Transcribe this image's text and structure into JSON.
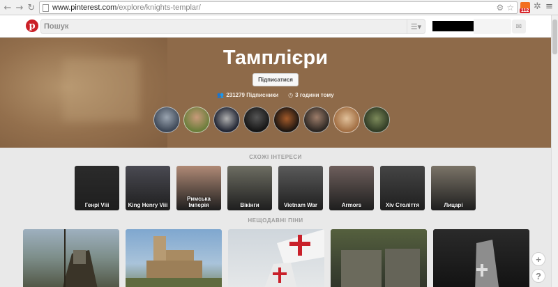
{
  "browser": {
    "url_host": "www.pinterest.com",
    "url_path": "/explore/knights-templar/",
    "ext_badge": "112"
  },
  "header": {
    "search_placeholder": "Пошук"
  },
  "hero": {
    "title": "Тамплієри",
    "follow_label": "Підписатися",
    "followers": "231279 Підписники",
    "updated": "3 години тому"
  },
  "related": {
    "heading": "СХОЖІ ІНТЕРЕСИ",
    "items": [
      {
        "label": "Генрі Viii",
        "color": "#2b2b2b"
      },
      {
        "label": "King Henry Viii",
        "color": "#4a4a52"
      },
      {
        "label": "Римська Імперія",
        "color": "#b08a76"
      },
      {
        "label": "Вікінги",
        "color": "#6d6d62"
      },
      {
        "label": "Vietnam War",
        "color": "#5a5a5a"
      },
      {
        "label": "Armors",
        "color": "#6e5f5c"
      },
      {
        "label": "Xiv Століття",
        "color": "#454545"
      },
      {
        "label": "Лицарі",
        "color": "#7b7468"
      }
    ]
  },
  "recent": {
    "heading": "НЕЩОДАВНІ ПІНИ"
  },
  "colors": {
    "brand_red": "#cb2027",
    "hero_brown": "#8e6a49"
  }
}
